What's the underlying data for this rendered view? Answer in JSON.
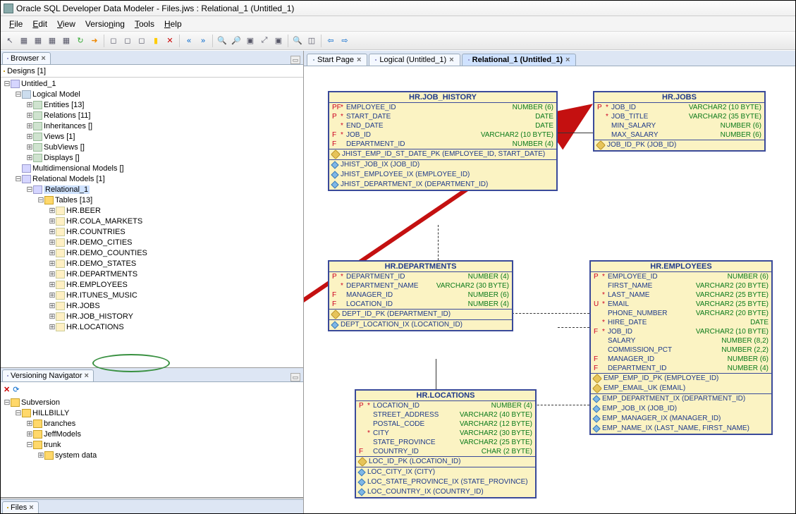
{
  "window": {
    "title": "Oracle SQL Developer Data Modeler - Files.jws : Relational_1 (Untitled_1)"
  },
  "menu": [
    "File",
    "Edit",
    "View",
    "Versioning",
    "Tools",
    "Help"
  ],
  "left": {
    "browser_tab": "Browser",
    "designs_hdr": "Designs [1]",
    "root": "Untitled_1",
    "logical": "Logical Model",
    "logical_children": [
      "Entities [13]",
      "Relations [11]",
      "Inheritances []",
      "Views [1]",
      "SubViews []",
      "Displays []"
    ],
    "multidim": "Multidimensional Models []",
    "relmodels": "Relational Models [1]",
    "rel1": "Relational_1",
    "tables_hdr": "Tables [13]",
    "tables": [
      "HR.BEER",
      "HR.COLA_MARKETS",
      "HR.COUNTRIES",
      "HR.DEMO_CITIES",
      "HR.DEMO_COUNTIES",
      "HR.DEMO_STATES",
      "HR.DEPARTMENTS",
      "HR.EMPLOYEES",
      "HR.ITUNES_MUSIC",
      "HR.JOBS",
      "HR.JOB_HISTORY",
      "HR.LOCATIONS"
    ],
    "ver_tab": "Versioning Navigator",
    "svn": "Subversion",
    "svn_repo": "HILLBILLY",
    "svn_children": [
      "branches",
      "JeffModels",
      "trunk"
    ],
    "svn_trunk_child": "system data",
    "files_tab": "Files"
  },
  "docs": {
    "tabs": [
      {
        "label": "Start Page",
        "active": false
      },
      {
        "label": "Logical (Untitled_1)",
        "active": false
      },
      {
        "label": "Relational_1 (Untitled_1)",
        "active": true
      }
    ]
  },
  "entities": {
    "job_history": {
      "title": "HR.JOB_HISTORY",
      "cols": [
        {
          "f": "PF",
          "s": "*",
          "n": "EMPLOYEE_ID",
          "t": "NUMBER (6)"
        },
        {
          "f": "P",
          "s": "*",
          "n": "START_DATE",
          "t": "DATE"
        },
        {
          "f": "",
          "s": "*",
          "n": "END_DATE",
          "t": "DATE"
        },
        {
          "f": "F",
          "s": "*",
          "n": "JOB_ID",
          "t": "VARCHAR2 (10 BYTE)"
        },
        {
          "f": "F",
          "s": "",
          "n": "DEPARTMENT_ID",
          "t": "NUMBER (4)"
        }
      ],
      "pk": "JHIST_EMP_ID_ST_DATE_PK (EMPLOYEE_ID, START_DATE)",
      "idx": [
        "JHIST_JOB_IX (JOB_ID)",
        "JHIST_EMPLOYEE_IX (EMPLOYEE_ID)",
        "JHIST_DEPARTMENT_IX (DEPARTMENT_ID)"
      ]
    },
    "jobs": {
      "title": "HR.JOBS",
      "cols": [
        {
          "f": "P",
          "s": "*",
          "n": "JOB_ID",
          "t": "VARCHAR2 (10 BYTE)"
        },
        {
          "f": "",
          "s": "*",
          "n": "JOB_TITLE",
          "t": "VARCHAR2 (35 BYTE)"
        },
        {
          "f": "",
          "s": "",
          "n": "MIN_SALARY",
          "t": "NUMBER (6)"
        },
        {
          "f": "",
          "s": "",
          "n": "MAX_SALARY",
          "t": "NUMBER (6)"
        }
      ],
      "pk": "JOB_ID_PK (JOB_ID)"
    },
    "departments": {
      "title": "HR.DEPARTMENTS",
      "cols": [
        {
          "f": "P",
          "s": "*",
          "n": "DEPARTMENT_ID",
          "t": "NUMBER (4)"
        },
        {
          "f": "",
          "s": "*",
          "n": "DEPARTMENT_NAME",
          "t": "VARCHAR2 (30 BYTE)"
        },
        {
          "f": "F",
          "s": "",
          "n": "MANAGER_ID",
          "t": "NUMBER (6)"
        },
        {
          "f": "F",
          "s": "",
          "n": "LOCATION_ID",
          "t": "NUMBER (4)"
        }
      ],
      "pk": "DEPT_ID_PK (DEPARTMENT_ID)",
      "idx": [
        "DEPT_LOCATION_IX (LOCATION_ID)"
      ]
    },
    "employees": {
      "title": "HR.EMPLOYEES",
      "cols": [
        {
          "f": "P",
          "s": "*",
          "n": "EMPLOYEE_ID",
          "t": "NUMBER (6)"
        },
        {
          "f": "",
          "s": "",
          "n": "FIRST_NAME",
          "t": "VARCHAR2 (20 BYTE)"
        },
        {
          "f": "",
          "s": "*",
          "n": "LAST_NAME",
          "t": "VARCHAR2 (25 BYTE)"
        },
        {
          "f": "U",
          "s": "*",
          "n": "EMAIL",
          "t": "VARCHAR2 (25 BYTE)"
        },
        {
          "f": "",
          "s": "",
          "n": "PHONE_NUMBER",
          "t": "VARCHAR2 (20 BYTE)"
        },
        {
          "f": "",
          "s": "*",
          "n": "HIRE_DATE",
          "t": "DATE"
        },
        {
          "f": "F",
          "s": "*",
          "n": "JOB_ID",
          "t": "VARCHAR2 (10 BYTE)"
        },
        {
          "f": "",
          "s": "",
          "n": "SALARY",
          "t": "NUMBER (8,2)"
        },
        {
          "f": "",
          "s": "",
          "n": "COMMISSION_PCT",
          "t": "NUMBER (2,2)"
        },
        {
          "f": "F",
          "s": "",
          "n": "MANAGER_ID",
          "t": "NUMBER (6)"
        },
        {
          "f": "F",
          "s": "",
          "n": "DEPARTMENT_ID",
          "t": "NUMBER (4)"
        }
      ],
      "pk": "EMP_EMP_ID_PK (EMPLOYEE_ID)",
      "uk": "EMP_EMAIL_UK (EMAIL)",
      "idx": [
        "EMP_DEPARTMENT_IX (DEPARTMENT_ID)",
        "EMP_JOB_IX (JOB_ID)",
        "EMP_MANAGER_IX (MANAGER_ID)",
        "EMP_NAME_IX (LAST_NAME, FIRST_NAME)"
      ]
    },
    "locations": {
      "title": "HR.LOCATIONS",
      "cols": [
        {
          "f": "P",
          "s": "*",
          "n": "LOCATION_ID",
          "t": "NUMBER (4)"
        },
        {
          "f": "",
          "s": "",
          "n": "STREET_ADDRESS",
          "t": "VARCHAR2 (40 BYTE)"
        },
        {
          "f": "",
          "s": "",
          "n": "POSTAL_CODE",
          "t": "VARCHAR2 (12 BYTE)"
        },
        {
          "f": "",
          "s": "*",
          "n": "CITY",
          "t": "VARCHAR2 (30 BYTE)"
        },
        {
          "f": "",
          "s": "",
          "n": "STATE_PROVINCE",
          "t": "VARCHAR2 (25 BYTE)"
        },
        {
          "f": "F",
          "s": "",
          "n": "COUNTRY_ID",
          "t": "CHAR (2 BYTE)"
        }
      ],
      "pk": "LOC_ID_PK (LOCATION_ID)",
      "idx": [
        "LOC_CITY_IX (CITY)",
        "LOC_STATE_PROVINCE_IX (STATE_PROVINCE)",
        "LOC_COUNTRY_IX (COUNTRY_ID)"
      ]
    }
  }
}
